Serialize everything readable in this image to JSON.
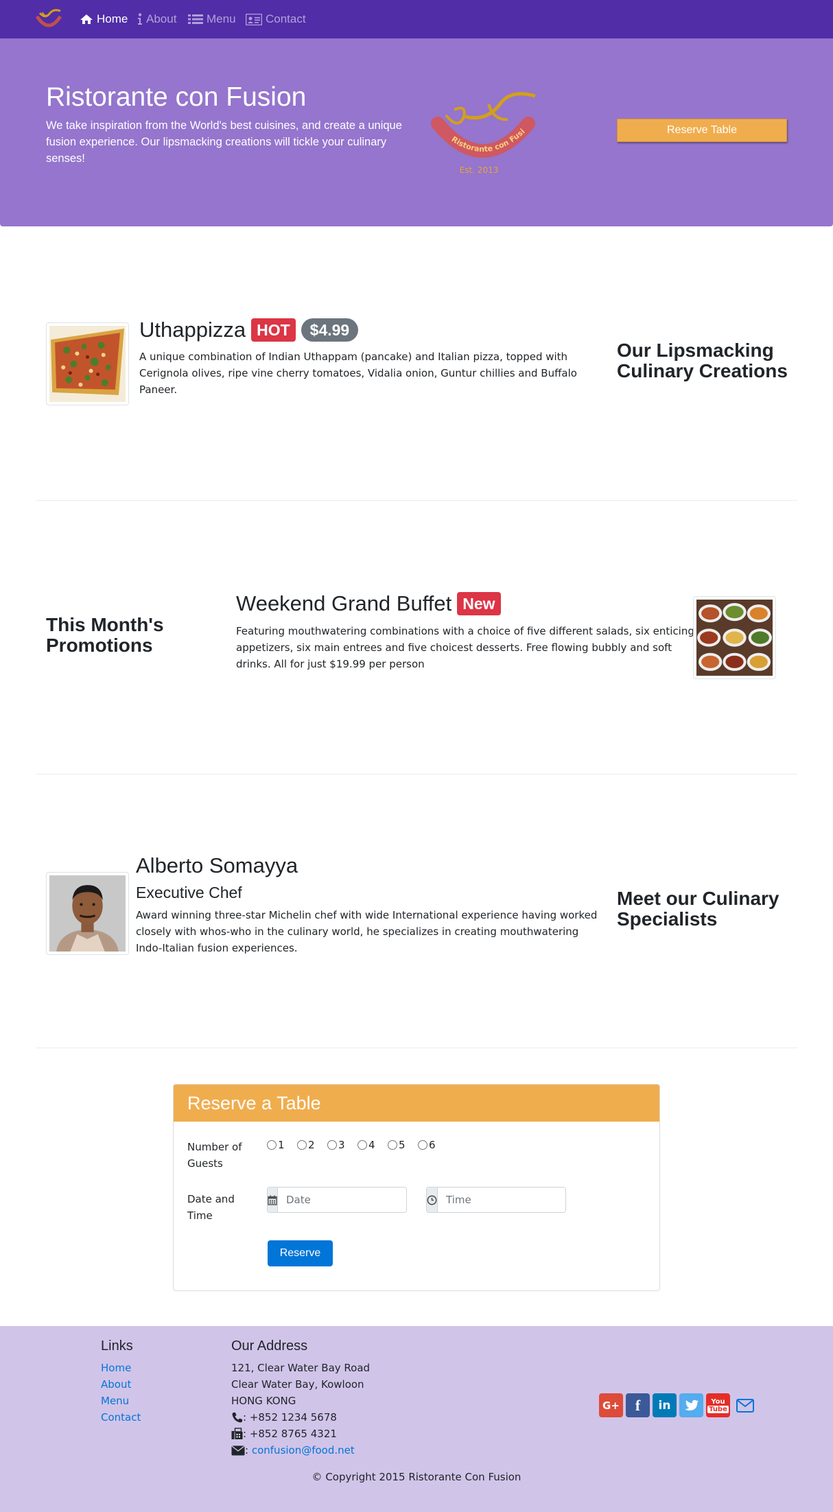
{
  "nav": {
    "items": [
      {
        "label": "Home",
        "icon": "home-icon"
      },
      {
        "label": "About",
        "icon": "info-icon"
      },
      {
        "label": "Menu",
        "icon": "list-icon"
      },
      {
        "label": "Contact",
        "icon": "address-card-icon"
      }
    ],
    "active": "Home"
  },
  "jumbotron": {
    "title": "Ristorante con Fusion",
    "text": "We take inspiration from the World's best cuisines, and create a unique fusion experience. Our lipsmacking creations will tickle your culinary senses!",
    "logo_text": "Ristorante con Fusion",
    "logo_est": "Est. 2013",
    "reserve_label": "Reserve Table"
  },
  "dish": {
    "name": "Uthappizza",
    "badge": "HOT",
    "price": "$4.99",
    "description": "A unique combination of Indian Uthappam (pancake) and Italian pizza, topped with Cerignola olives, ripe vine cherry tomatoes, Vidalia onion, Guntur chillies and Buffalo Paneer.",
    "heading": "Our Lipsmacking Culinary Creations"
  },
  "promotion": {
    "heading": "This Month's Promotions",
    "name": "Weekend Grand Buffet",
    "badge": "New",
    "description": "Featuring mouthwatering combinations with a choice of five different salads, six enticing appetizers, six main entrees and five choicest desserts. Free flowing bubbly and soft drinks. All for just $19.99 per person"
  },
  "leader": {
    "name": "Alberto Somayya",
    "designation": "Executive Chef",
    "description": "Award winning three-star Michelin chef with wide International experience having worked closely with whos-who in the culinary world, he specializes in creating mouthwatering Indo-Italian fusion experiences.",
    "heading": "Meet our Culinary Specialists"
  },
  "reserve": {
    "title": "Reserve a Table",
    "guests_label": "Number of Guests",
    "guest_options": [
      "1",
      "2",
      "3",
      "4",
      "5",
      "6"
    ],
    "datetime_label": "Date and Time",
    "date_placeholder": "Date",
    "time_placeholder": "Time",
    "button": "Reserve"
  },
  "footer": {
    "links_title": "Links",
    "links": [
      "Home",
      "About",
      "Menu",
      "Contact"
    ],
    "address_title": "Our Address",
    "address_lines": [
      "121, Clear Water Bay Road",
      "Clear Water Bay, Kowloon",
      "HONG KONG"
    ],
    "phone": ": +852 1234 5678",
    "fax": ": +852 8765 4321",
    "email_prefix": ":",
    "email": "confusion@food.net",
    "social": [
      "google-plus",
      "facebook",
      "linkedin",
      "twitter",
      "youtube",
      "mail"
    ],
    "copyright": "© Copyright 2015 Ristorante Con Fusion"
  },
  "colors": {
    "navbar": "#512DA8",
    "jumbotron": "#9575CD",
    "footer": "#D1C4E9",
    "warning": "#F0AD4E",
    "danger": "#dc3545",
    "primary": "#0275d8"
  }
}
